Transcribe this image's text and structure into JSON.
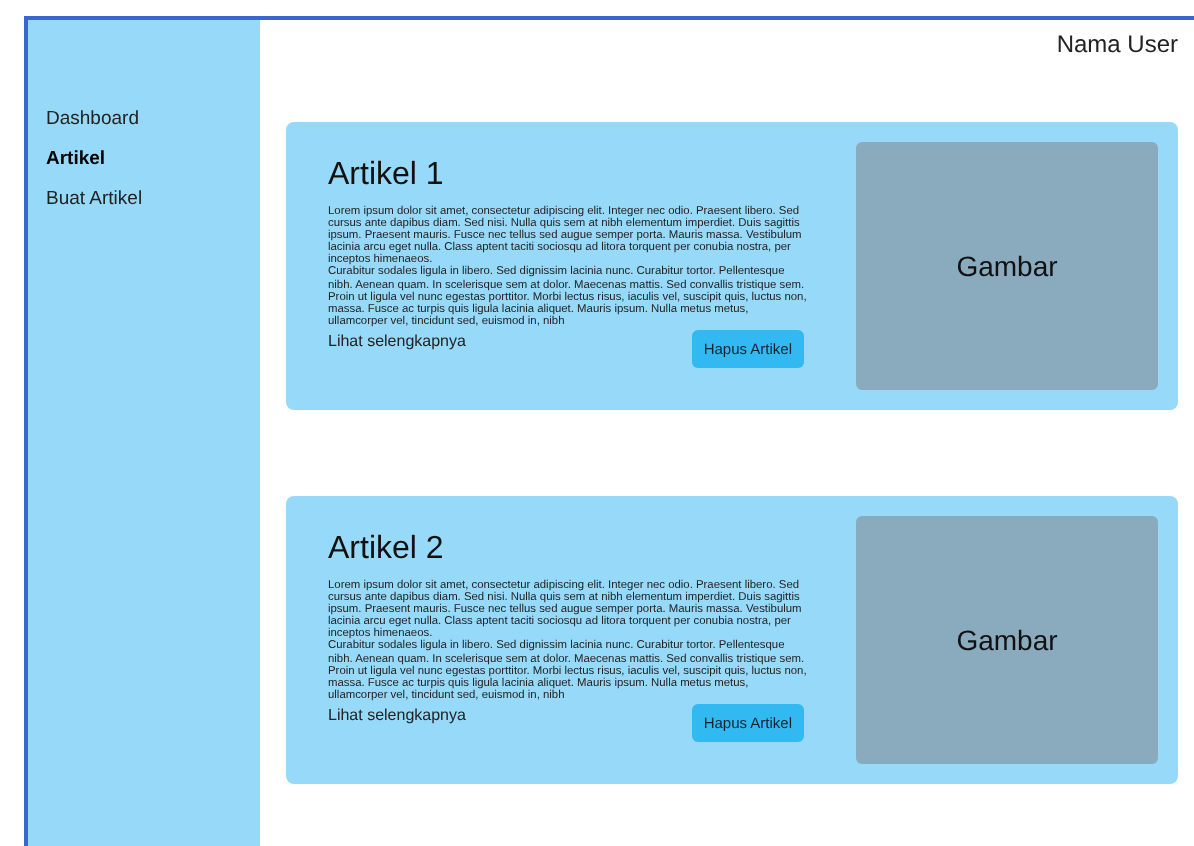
{
  "header": {
    "user": "Nama User"
  },
  "sidebar": {
    "items": [
      {
        "label": "Dashboard",
        "selected": false
      },
      {
        "label": "Artikel",
        "selected": true
      },
      {
        "label": "Buat Artikel",
        "selected": false
      }
    ]
  },
  "articles": [
    {
      "title": "Artikel 1",
      "paragraphs": [
        "Lorem ipsum dolor sit amet, consectetur adipiscing elit. Integer nec odio. Praesent libero. Sed cursus ante dapibus diam. Sed nisi. Nulla quis sem at nibh elementum imperdiet. Duis sagittis ipsum. Praesent mauris. Fusce nec tellus sed augue semper porta. Mauris massa. Vestibulum lacinia arcu eget nulla. Class aptent taciti sociosqu ad litora torquent per conubia nostra, per inceptos himenaeos.",
        "Curabitur sodales ligula in libero. Sed dignissim lacinia nunc. Curabitur tortor. Pellentesque nibh. Aenean quam. In scelerisque sem at dolor. Maecenas mattis. Sed convallis tristique sem. Proin ut ligula vel nunc egestas porttitor. Morbi lectus risus, iaculis vel, suscipit quis, luctus non, massa. Fusce ac turpis quis ligula lacinia aliquet. Mauris ipsum. Nulla metus metus, ullamcorper vel, tincidunt sed, euismod in, nibh"
      ],
      "link": "Lihat selengkapnya",
      "button": "Hapus Artikel",
      "image_label": "Gambar"
    },
    {
      "title": "Artikel 2",
      "paragraphs": [
        "Lorem ipsum dolor sit amet, consectetur adipiscing elit. Integer nec odio. Praesent libero. Sed cursus ante dapibus diam. Sed nisi. Nulla quis sem at nibh elementum imperdiet. Duis sagittis ipsum. Praesent mauris. Fusce nec tellus sed augue semper porta. Mauris massa. Vestibulum lacinia arcu eget nulla. Class aptent taciti sociosqu ad litora torquent per conubia nostra, per inceptos himenaeos.",
        "Curabitur sodales ligula in libero. Sed dignissim lacinia nunc. Curabitur tortor. Pellentesque nibh. Aenean quam. In scelerisque sem at dolor. Maecenas mattis. Sed convallis tristique sem. Proin ut ligula vel nunc egestas porttitor. Morbi lectus risus, iaculis vel, suscipit quis, luctus non, massa. Fusce ac turpis quis ligula lacinia aliquet. Mauris ipsum. Nulla metus metus, ullamcorper vel, tincidunt sed, euismod in, nibh"
      ],
      "link": "Lihat selengkapnya",
      "button": "Hapus Artikel",
      "image_label": "Gambar"
    }
  ]
}
